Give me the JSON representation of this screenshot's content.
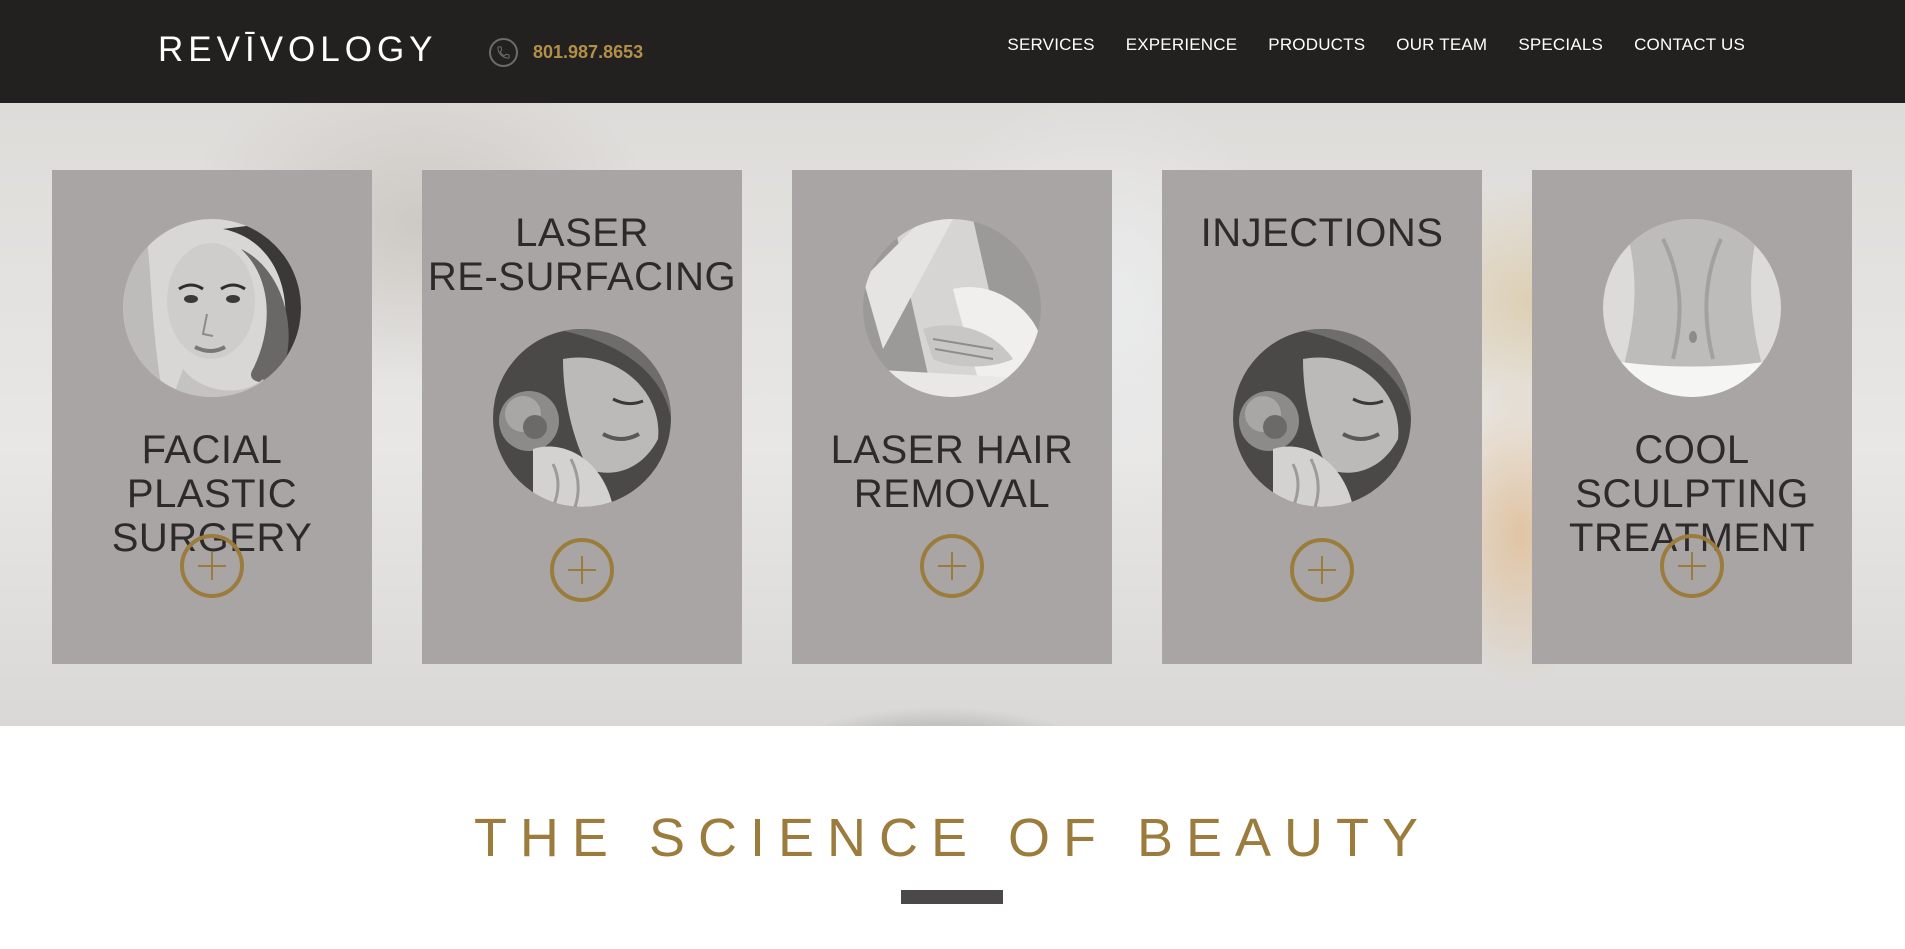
{
  "header": {
    "logo": "REVĪVOLOGY",
    "phone": "801.987.8653",
    "phone_icon": "phone-icon",
    "nav": [
      "SERVICES",
      "EXPERIENCE",
      "PRODUCTS",
      "OUR TEAM",
      "SPECIALS",
      "CONTACT US"
    ]
  },
  "cards": [
    {
      "title": "FACIAL PLASTIC\nSURGERY",
      "photo": "woman-portrait-photo"
    },
    {
      "title": "LASER\nRE-SURFACING",
      "photo": "woman-flower-photo"
    },
    {
      "title": "LASER HAIR\nREMOVAL",
      "photo": "legs-massage-photo"
    },
    {
      "title": "INJECTIONS",
      "photo": "woman-flower-photo"
    },
    {
      "title": "COOL SCULPTING\nTREATMENT",
      "photo": "torso-photo"
    }
  ],
  "section": {
    "title": "THE SCIENCE OF BEAUTY"
  },
  "colors": {
    "header_bg": "#222120",
    "accent_gold": "#9b7c3c",
    "phone_gold": "#b38f4a",
    "card_bg": "#a8a5a4"
  }
}
